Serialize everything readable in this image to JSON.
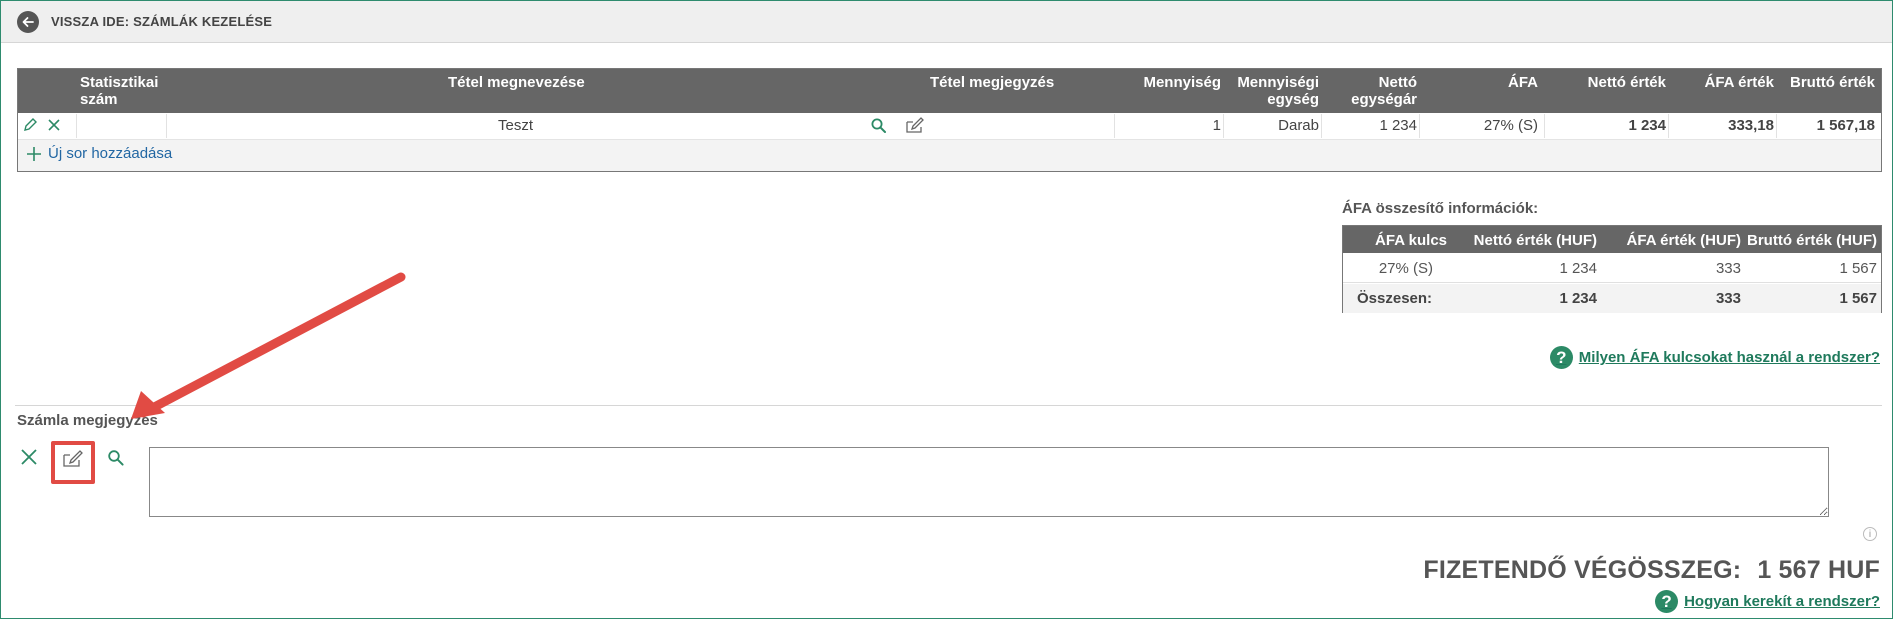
{
  "topbar": {
    "back_label": "VISSZA IDE: SZÁMLÁK KEZELÉSE"
  },
  "items_table": {
    "headers": {
      "stat_1": "Statisztikai",
      "stat_2": "szám",
      "name": "Tétel megnevezése",
      "note": "Tétel megjegyzés",
      "qty": "Mennyiség",
      "unit_1": "Mennyiségi",
      "unit_2": "egység",
      "net_unit_1": "Nettó",
      "net_unit_2": "egységár",
      "vat": "ÁFA",
      "net_value": "Nettó érték",
      "vat_value": "ÁFA érték",
      "gross_value": "Bruttó érték"
    },
    "rows": [
      {
        "stat_num": "",
        "name": "Teszt",
        "note": "",
        "qty": "1",
        "unit": "Darab",
        "net_unit_price": "1 234",
        "vat": "27% (S)",
        "net_value": "1 234",
        "vat_value": "333,18",
        "gross_value": "1 567,18"
      }
    ],
    "add_row_label": "Új sor hozzáadása"
  },
  "vat_summary": {
    "title": "ÁFA összesítő információk:",
    "headers": {
      "rate": "ÁFA kulcs",
      "net": "Nettó érték (HUF)",
      "vat": "ÁFA érték (HUF)",
      "gross": "Bruttó érték (HUF)"
    },
    "rows": [
      {
        "rate": "27% (S)",
        "net": "1 234",
        "vat": "333",
        "gross": "1 567"
      }
    ],
    "total": {
      "label": "Összesen:",
      "net": "1 234",
      "vat": "333",
      "gross": "1 567"
    }
  },
  "help_vat_link": "Milyen ÁFA kulcsokat használ a rendszer?",
  "invoice_note": {
    "label": "Számla megjegyzés",
    "value": ""
  },
  "info_glyph": "i",
  "total": {
    "label": "FIZETENDŐ VÉGÖSSZEG:",
    "amount": "1 567 HUF"
  },
  "help_rounding_link": "Hogyan kerekít a rendszer?",
  "colors": {
    "accent": "#2c8a66",
    "header_bg": "#666666",
    "link_blue": "#2267a3",
    "annotation_red": "#e14b44"
  },
  "icons": [
    "arrow-left-icon",
    "pencil-icon",
    "close-icon",
    "search-icon",
    "edit-note-icon",
    "plus-icon",
    "question-icon",
    "info-icon"
  ]
}
